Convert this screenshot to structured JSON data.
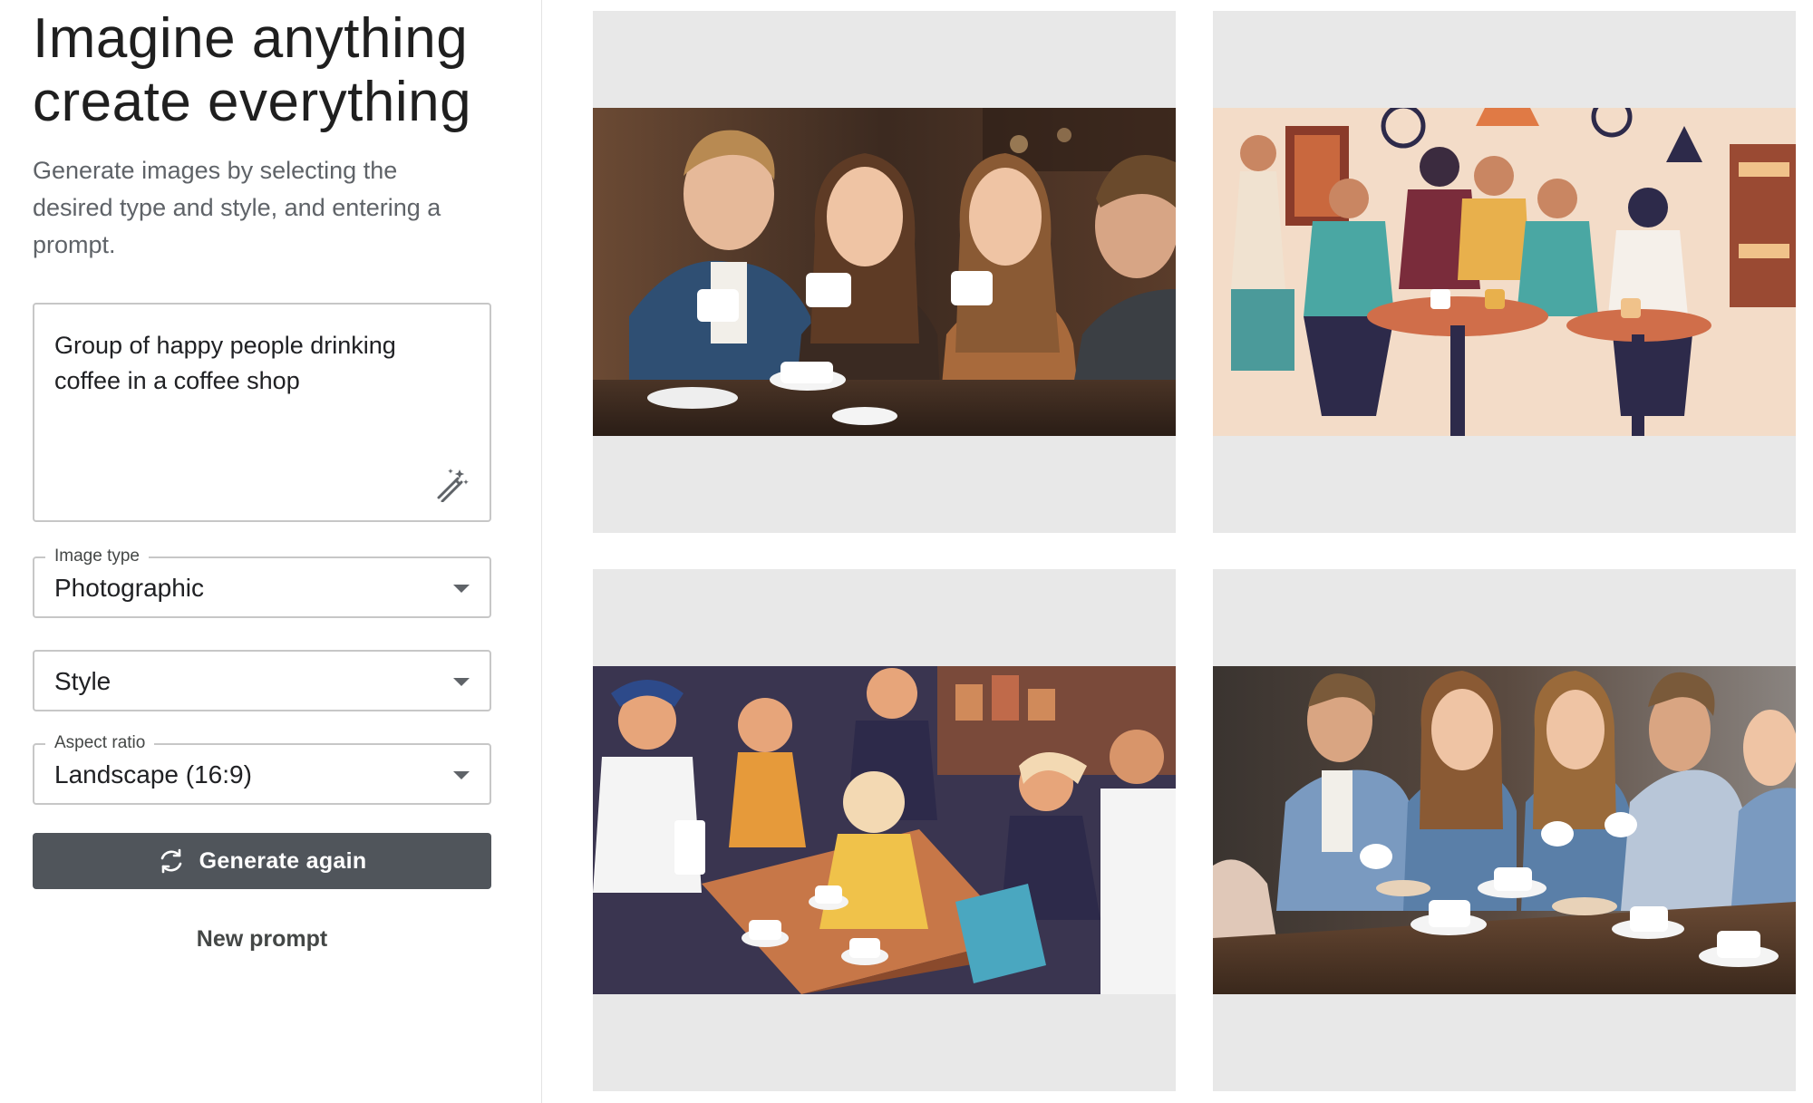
{
  "hero": {
    "line1": "Imagine anything",
    "line2": "create everything",
    "subtitle": "Generate images by selecting the desired type and style, and entering a prompt."
  },
  "prompt": {
    "text": "Group of happy people drinking coffee in a coffee shop",
    "icon": "magic-wand-icon"
  },
  "image_type": {
    "label": "Image type",
    "value": "Photographic"
  },
  "style": {
    "value": "Style"
  },
  "aspect_ratio": {
    "label": "Aspect ratio",
    "value": "Landscape (16:9)"
  },
  "actions": {
    "generate_label": "Generate again",
    "generate_icon": "refresh-icon",
    "new_prompt_label": "New prompt"
  },
  "colors": {
    "button_bg": "#50555b",
    "card_bg": "#e8e8e8",
    "border": "#c7c7c7"
  }
}
